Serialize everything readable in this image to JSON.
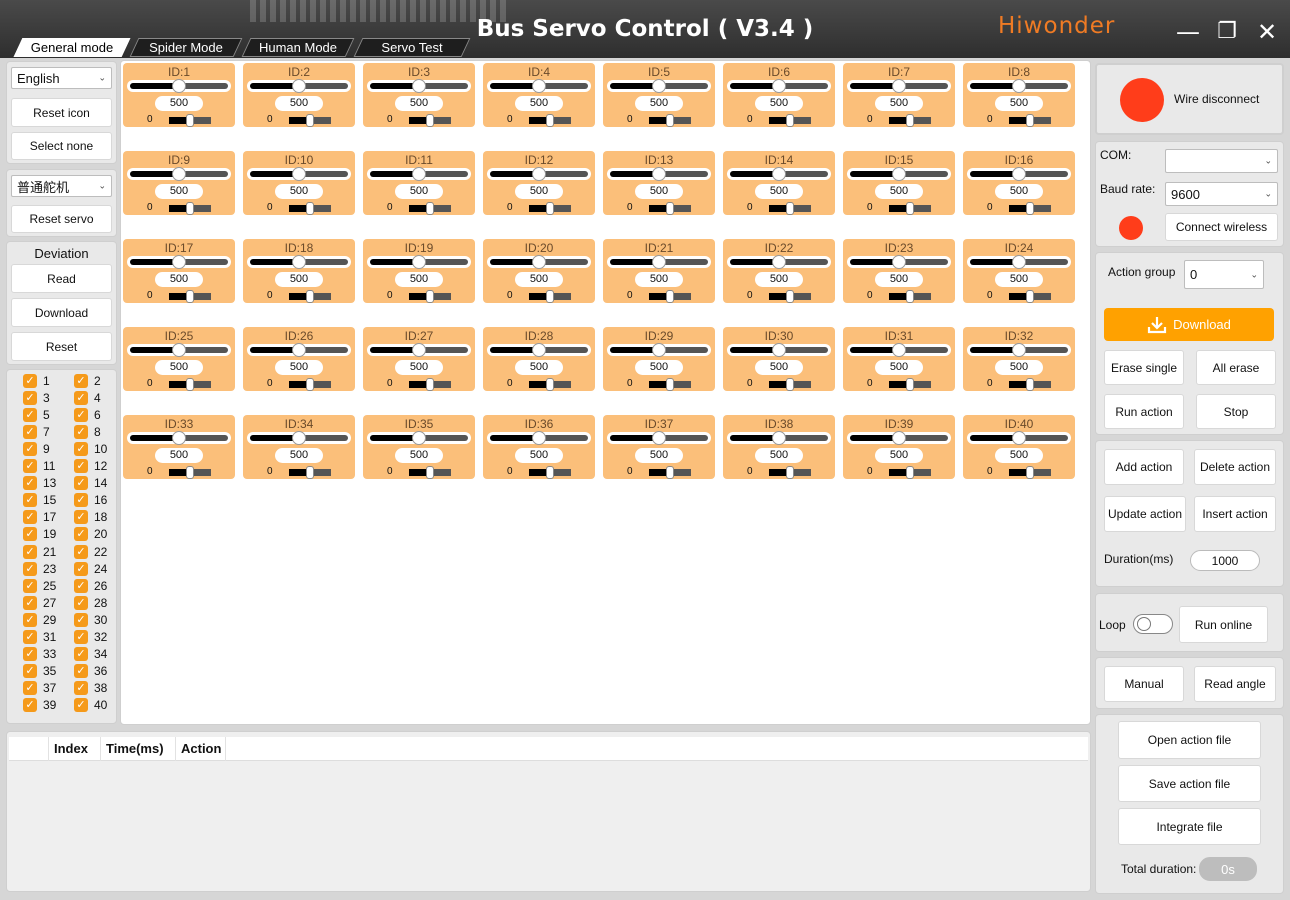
{
  "header": {
    "title": "Bus Servo Control ( V3.4 )",
    "brand": "Hiwonder",
    "minimize_icon": "minimize-icon",
    "maximize_icon": "maximize-icon",
    "close_icon": "close-icon",
    "accent": "#f07b24"
  },
  "tabs": [
    {
      "label": "General mode",
      "active": true
    },
    {
      "label": "Spider Mode",
      "active": false
    },
    {
      "label": "Human Mode",
      "active": false
    },
    {
      "label": "Servo Test",
      "active": false
    }
  ],
  "sidebar": {
    "language_select": "English",
    "reset_icon": "Reset icon",
    "select_none": "Select none",
    "servo_type_select": "普通舵机",
    "reset_servo": "Reset servo",
    "deviation": {
      "title": "Deviation",
      "read": "Read",
      "download": "Download",
      "reset": "Reset"
    },
    "checkbox_color": "#f59a1a",
    "checkboxes": [
      "1",
      "2",
      "3",
      "4",
      "5",
      "6",
      "7",
      "8",
      "9",
      "10",
      "11",
      "12",
      "13",
      "14",
      "15",
      "16",
      "17",
      "18",
      "19",
      "20",
      "21",
      "22",
      "23",
      "24",
      "25",
      "26",
      "27",
      "28",
      "29",
      "30",
      "31",
      "32",
      "33",
      "34",
      "35",
      "36",
      "37",
      "38",
      "39",
      "40"
    ]
  },
  "servos": [
    {
      "id": "ID:1",
      "value": "500",
      "position": 500,
      "deviation_label": "0"
    },
    {
      "id": "ID:2",
      "value": "500",
      "position": 500,
      "deviation_label": "0"
    },
    {
      "id": "ID:3",
      "value": "500",
      "position": 500,
      "deviation_label": "0"
    },
    {
      "id": "ID:4",
      "value": "500",
      "position": 500,
      "deviation_label": "0"
    },
    {
      "id": "ID:5",
      "value": "500",
      "position": 500,
      "deviation_label": "0"
    },
    {
      "id": "ID:6",
      "value": "500",
      "position": 500,
      "deviation_label": "0"
    },
    {
      "id": "ID:7",
      "value": "500",
      "position": 500,
      "deviation_label": "0"
    },
    {
      "id": "ID:8",
      "value": "500",
      "position": 500,
      "deviation_label": "0"
    },
    {
      "id": "ID:9",
      "value": "500",
      "position": 500,
      "deviation_label": "0"
    },
    {
      "id": "ID:10",
      "value": "500",
      "position": 500,
      "deviation_label": "0"
    },
    {
      "id": "ID:11",
      "value": "500",
      "position": 500,
      "deviation_label": "0"
    },
    {
      "id": "ID:12",
      "value": "500",
      "position": 500,
      "deviation_label": "0"
    },
    {
      "id": "ID:13",
      "value": "500",
      "position": 500,
      "deviation_label": "0"
    },
    {
      "id": "ID:14",
      "value": "500",
      "position": 500,
      "deviation_label": "0"
    },
    {
      "id": "ID:15",
      "value": "500",
      "position": 500,
      "deviation_label": "0"
    },
    {
      "id": "ID:16",
      "value": "500",
      "position": 500,
      "deviation_label": "0"
    },
    {
      "id": "ID:17",
      "value": "500",
      "position": 500,
      "deviation_label": "0"
    },
    {
      "id": "ID:18",
      "value": "500",
      "position": 500,
      "deviation_label": "0"
    },
    {
      "id": "ID:19",
      "value": "500",
      "position": 500,
      "deviation_label": "0"
    },
    {
      "id": "ID:20",
      "value": "500",
      "position": 500,
      "deviation_label": "0"
    },
    {
      "id": "ID:21",
      "value": "500",
      "position": 500,
      "deviation_label": "0"
    },
    {
      "id": "ID:22",
      "value": "500",
      "position": 500,
      "deviation_label": "0"
    },
    {
      "id": "ID:23",
      "value": "500",
      "position": 500,
      "deviation_label": "0"
    },
    {
      "id": "ID:24",
      "value": "500",
      "position": 500,
      "deviation_label": "0"
    },
    {
      "id": "ID:25",
      "value": "500",
      "position": 500,
      "deviation_label": "0"
    },
    {
      "id": "ID:26",
      "value": "500",
      "position": 500,
      "deviation_label": "0"
    },
    {
      "id": "ID:27",
      "value": "500",
      "position": 500,
      "deviation_label": "0"
    },
    {
      "id": "ID:28",
      "value": "500",
      "position": 500,
      "deviation_label": "0"
    },
    {
      "id": "ID:29",
      "value": "500",
      "position": 500,
      "deviation_label": "0"
    },
    {
      "id": "ID:30",
      "value": "500",
      "position": 500,
      "deviation_label": "0"
    },
    {
      "id": "ID:31",
      "value": "500",
      "position": 500,
      "deviation_label": "0"
    },
    {
      "id": "ID:32",
      "value": "500",
      "position": 500,
      "deviation_label": "0"
    },
    {
      "id": "ID:33",
      "value": "500",
      "position": 500,
      "deviation_label": "0"
    },
    {
      "id": "ID:34",
      "value": "500",
      "position": 500,
      "deviation_label": "0"
    },
    {
      "id": "ID:35",
      "value": "500",
      "position": 500,
      "deviation_label": "0"
    },
    {
      "id": "ID:36",
      "value": "500",
      "position": 500,
      "deviation_label": "0"
    },
    {
      "id": "ID:37",
      "value": "500",
      "position": 500,
      "deviation_label": "0"
    },
    {
      "id": "ID:38",
      "value": "500",
      "position": 500,
      "deviation_label": "0"
    },
    {
      "id": "ID:39",
      "value": "500",
      "position": 500,
      "deviation_label": "0"
    },
    {
      "id": "ID:40",
      "value": "500",
      "position": 500,
      "deviation_label": "0"
    }
  ],
  "servo_card_color": "#fbbf7a",
  "table": {
    "columns": [
      "",
      "Index",
      "Time(ms)",
      "Action"
    ]
  },
  "right": {
    "wire_status": "Wire disconnect",
    "status_color": "#ff3d1a",
    "com_label": "COM:",
    "com_value": "",
    "baud_label": "Baud rate:",
    "baud_value": "9600",
    "connect_wireless": "Connect wireless",
    "action_group_label": "Action group",
    "action_group_value": "0",
    "download": "Download",
    "download_icon": "download-icon",
    "download_color": "#ffa100",
    "erase_single": "Erase single",
    "all_erase": "All erase",
    "run_action": "Run action",
    "stop": "Stop",
    "add_action": "Add action",
    "delete_action": "Delete action",
    "update_action": "Update action",
    "insert_action": "Insert action",
    "duration_label": "Duration(ms)",
    "duration_value": "1000",
    "loop_label": "Loop",
    "run_online": "Run online",
    "manual": "Manual",
    "read_angle": "Read angle",
    "open_action_file": "Open action file",
    "save_action_file": "Save action file",
    "integrate_file": "Integrate file",
    "total_duration_label": "Total duration:",
    "total_duration_value": "0s"
  }
}
